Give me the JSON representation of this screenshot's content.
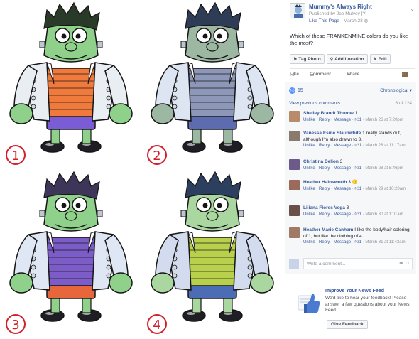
{
  "post": {
    "page_name": "Mummy's Always Right",
    "published_by": "Published by Joe Mulvey",
    "published_suffix": "[?]",
    "like_page": "Like This Page",
    "date": "March 23",
    "caption": "Which of these FRANKENMINE colors do you like the most?",
    "more_icon": "chevron-down-icon"
  },
  "buttons": {
    "tag_photo": "Tag Photo",
    "add_location": "Add Location",
    "edit": "Edit"
  },
  "actions": {
    "like": "Like",
    "comment": "Comment",
    "share": "Share"
  },
  "reactions": {
    "count": "15",
    "order": "Chronological"
  },
  "comments_header": {
    "view_previous": "View previous comments",
    "count": "6 of 124"
  },
  "comment_actions": {
    "unlike": "Unlike",
    "reply": "Reply",
    "message": "Message"
  },
  "comments": [
    {
      "name": "Shelley Brandt Thurow",
      "text": "1",
      "likes": "1",
      "time": "March 26 at 7:20pm"
    },
    {
      "name": "Vanessa Esmé Slaunwhite",
      "text": "1 really stands out, although I'm also drawn to 3.",
      "likes": "1",
      "time": "March 28 at 11:17am"
    },
    {
      "name": "Christina Delion",
      "text": "3",
      "likes": "1",
      "time": "March 28 at 5:46pm"
    },
    {
      "name": "Heather Hainsworth",
      "text": "3 🙂",
      "likes": "1",
      "time": "March 29 at 10:20am"
    },
    {
      "name": "Liliana Flores Vega",
      "text": "3",
      "likes": "1",
      "time": "March 30 at 1:01am"
    },
    {
      "name": "Heather Marie Canham",
      "text": "I like the body/hair coloring of 1, but like the clothing of 4.",
      "likes": "1",
      "time": "March 31 at 11:43am"
    }
  ],
  "composer": {
    "placeholder": "Write a comment..."
  },
  "feedback": {
    "title": "Improve Your News Feed",
    "description": "We'd like to hear your feedback! Please answer a few questions about your News Feed.",
    "button": "Give Feedback"
  },
  "panels": [
    {
      "label": "1",
      "skin": "#8fd18a",
      "shirt": "#f07a3c",
      "shorts": "#7a5cd6",
      "hair": "#2a3a28",
      "jacket": "#e9eef3"
    },
    {
      "label": "2",
      "skin": "#9db8a2",
      "shirt": "#8d97b8",
      "shorts": "#5d6bb0",
      "hair": "#2f3c56",
      "jacket": "#dde4f2"
    },
    {
      "label": "3",
      "skin": "#8fd18a",
      "shirt": "#7c5cc6",
      "shorts": "#e8663b",
      "hair": "#3e3658",
      "jacket": "#dfe6f4"
    },
    {
      "label": "4",
      "skin": "#a9d79f",
      "shirt": "#b9d04c",
      "shorts": "#4c6cb5",
      "hair": "#2c3f5e",
      "jacket": "#d3dcef"
    }
  ],
  "colors": {
    "link": "#365899",
    "number_marker": "#d0202a",
    "like_blue": "#5890ff"
  }
}
